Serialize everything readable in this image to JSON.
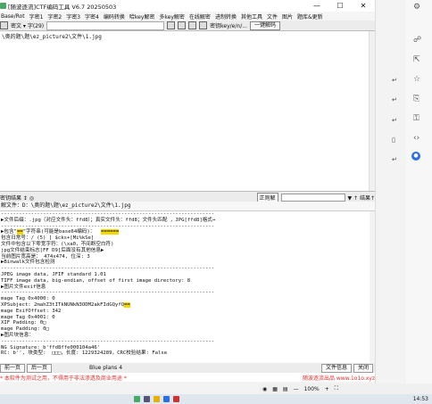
{
  "window": {
    "title": "[随波逐流]CTF编码工具 V6.7  20250503",
    "min": "—",
    "max": "☐",
    "close": "✕"
  },
  "menu": [
    "Base/Rot",
    "字密1",
    "字密2",
    "字密3",
    "字密4",
    "编码转换",
    "哈key解密",
    "多key解密",
    "在线解密",
    "进制转换",
    "其他工具",
    "文件",
    "图片",
    "题库&更新"
  ],
  "toolbar": {
    "encoding_label": "密文 ▾ 字(29)",
    "key_label": "密钥key/e/n/...",
    "one_key_button": "一键解码"
  },
  "editor": {
    "content": "\\奥的题\\题\\ez_picture2\\文件\\1.jpg"
  },
  "bar2": {
    "label": "密钥结果 ↕ ◎",
    "regex_button": "正则解",
    "nav": "▼ ↑ 结果↑"
  },
  "path_line": "解文件：D：\\奥的题\\题\\ez_picture2\\文件\\1.jpg",
  "output_lines": [
    "-----------------------------------------------------------------------",
    "▶文件后缀：.jpg（对应文件头：ffd8）；真实文件头：ffd8；文件头匹配 ，JPG[ffd8]格式→",
    "-----------------------------------------------------------------------",
    "▶包含\"==\"字符串(可能是base64编码)：  ======",
    "包含日常号：/ (5) [ $cks+[Mi%kSe]",
    "文件中包含以下零宽字符：(\\xa0，不间断空白符)",
    "jpg文件结束标志[FF D9]后面没有其他信息▶",
    "当前图片宽高是： 474x474, 位深: 3",
    "▶Binwalk文件包含检测",
    "-----------------------------------------------------------------------",
    "JPEG image data, JFIF standard 1.01",
    "TIFF image data, big-endian, offset of first image directory: 8",
    "▶图片文件exif信息",
    "-----------------------------------------------------------------------",
    "mage Tag 0x4000: 0",
    "XPSubject: 2mahZ3tITkNUNkN3ODM2akFIdGQyfQ==",
    "mage ExifOffset: 342",
    "mage Tag 0x4001: 0",
    "XIF Padding: 0□",
    "mage Padding: 0□",
    "",
    "▶图片块信息：",
    "-----------------------------------------------------------------------",
    "NG Signature: b'ffd8ffe000104a46'",
    "RC: b'', 块类型:  □□□，长度: 1229324289，CRC校验结果: False"
  ],
  "bottom": {
    "prev": "前一页",
    "next": "后一页",
    "mode": "Blue plans 4",
    "file_info": "文件信息",
    "close": "关闭"
  },
  "status": {
    "left": "* 本软件为测试之用，不得用于非法渗透及商业用途 *",
    "right": "随波逐流出品 www.1o1o.xyz"
  },
  "browser": {
    "zoom": "100%",
    "plus": "+",
    "minus": "—"
  },
  "taskbar": {
    "clock": "14:53"
  }
}
